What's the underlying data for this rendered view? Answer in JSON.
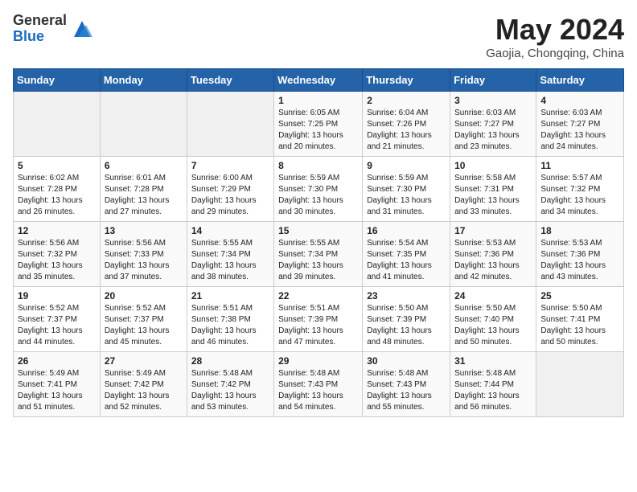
{
  "header": {
    "logo_general": "General",
    "logo_blue": "Blue",
    "month_title": "May 2024",
    "location": "Gaojia, Chongqing, China"
  },
  "days_of_week": [
    "Sunday",
    "Monday",
    "Tuesday",
    "Wednesday",
    "Thursday",
    "Friday",
    "Saturday"
  ],
  "weeks": [
    [
      {
        "day": "",
        "info": ""
      },
      {
        "day": "",
        "info": ""
      },
      {
        "day": "",
        "info": ""
      },
      {
        "day": "1",
        "info": "Sunrise: 6:05 AM\nSunset: 7:25 PM\nDaylight: 13 hours and 20 minutes."
      },
      {
        "day": "2",
        "info": "Sunrise: 6:04 AM\nSunset: 7:26 PM\nDaylight: 13 hours and 21 minutes."
      },
      {
        "day": "3",
        "info": "Sunrise: 6:03 AM\nSunset: 7:27 PM\nDaylight: 13 hours and 23 minutes."
      },
      {
        "day": "4",
        "info": "Sunrise: 6:03 AM\nSunset: 7:27 PM\nDaylight: 13 hours and 24 minutes."
      }
    ],
    [
      {
        "day": "5",
        "info": "Sunrise: 6:02 AM\nSunset: 7:28 PM\nDaylight: 13 hours and 26 minutes."
      },
      {
        "day": "6",
        "info": "Sunrise: 6:01 AM\nSunset: 7:28 PM\nDaylight: 13 hours and 27 minutes."
      },
      {
        "day": "7",
        "info": "Sunrise: 6:00 AM\nSunset: 7:29 PM\nDaylight: 13 hours and 29 minutes."
      },
      {
        "day": "8",
        "info": "Sunrise: 5:59 AM\nSunset: 7:30 PM\nDaylight: 13 hours and 30 minutes."
      },
      {
        "day": "9",
        "info": "Sunrise: 5:59 AM\nSunset: 7:30 PM\nDaylight: 13 hours and 31 minutes."
      },
      {
        "day": "10",
        "info": "Sunrise: 5:58 AM\nSunset: 7:31 PM\nDaylight: 13 hours and 33 minutes."
      },
      {
        "day": "11",
        "info": "Sunrise: 5:57 AM\nSunset: 7:32 PM\nDaylight: 13 hours and 34 minutes."
      }
    ],
    [
      {
        "day": "12",
        "info": "Sunrise: 5:56 AM\nSunset: 7:32 PM\nDaylight: 13 hours and 35 minutes."
      },
      {
        "day": "13",
        "info": "Sunrise: 5:56 AM\nSunset: 7:33 PM\nDaylight: 13 hours and 37 minutes."
      },
      {
        "day": "14",
        "info": "Sunrise: 5:55 AM\nSunset: 7:34 PM\nDaylight: 13 hours and 38 minutes."
      },
      {
        "day": "15",
        "info": "Sunrise: 5:55 AM\nSunset: 7:34 PM\nDaylight: 13 hours and 39 minutes."
      },
      {
        "day": "16",
        "info": "Sunrise: 5:54 AM\nSunset: 7:35 PM\nDaylight: 13 hours and 41 minutes."
      },
      {
        "day": "17",
        "info": "Sunrise: 5:53 AM\nSunset: 7:36 PM\nDaylight: 13 hours and 42 minutes."
      },
      {
        "day": "18",
        "info": "Sunrise: 5:53 AM\nSunset: 7:36 PM\nDaylight: 13 hours and 43 minutes."
      }
    ],
    [
      {
        "day": "19",
        "info": "Sunrise: 5:52 AM\nSunset: 7:37 PM\nDaylight: 13 hours and 44 minutes."
      },
      {
        "day": "20",
        "info": "Sunrise: 5:52 AM\nSunset: 7:37 PM\nDaylight: 13 hours and 45 minutes."
      },
      {
        "day": "21",
        "info": "Sunrise: 5:51 AM\nSunset: 7:38 PM\nDaylight: 13 hours and 46 minutes."
      },
      {
        "day": "22",
        "info": "Sunrise: 5:51 AM\nSunset: 7:39 PM\nDaylight: 13 hours and 47 minutes."
      },
      {
        "day": "23",
        "info": "Sunrise: 5:50 AM\nSunset: 7:39 PM\nDaylight: 13 hours and 48 minutes."
      },
      {
        "day": "24",
        "info": "Sunrise: 5:50 AM\nSunset: 7:40 PM\nDaylight: 13 hours and 50 minutes."
      },
      {
        "day": "25",
        "info": "Sunrise: 5:50 AM\nSunset: 7:41 PM\nDaylight: 13 hours and 50 minutes."
      }
    ],
    [
      {
        "day": "26",
        "info": "Sunrise: 5:49 AM\nSunset: 7:41 PM\nDaylight: 13 hours and 51 minutes."
      },
      {
        "day": "27",
        "info": "Sunrise: 5:49 AM\nSunset: 7:42 PM\nDaylight: 13 hours and 52 minutes."
      },
      {
        "day": "28",
        "info": "Sunrise: 5:48 AM\nSunset: 7:42 PM\nDaylight: 13 hours and 53 minutes."
      },
      {
        "day": "29",
        "info": "Sunrise: 5:48 AM\nSunset: 7:43 PM\nDaylight: 13 hours and 54 minutes."
      },
      {
        "day": "30",
        "info": "Sunrise: 5:48 AM\nSunset: 7:43 PM\nDaylight: 13 hours and 55 minutes."
      },
      {
        "day": "31",
        "info": "Sunrise: 5:48 AM\nSunset: 7:44 PM\nDaylight: 13 hours and 56 minutes."
      },
      {
        "day": "",
        "info": ""
      }
    ]
  ]
}
